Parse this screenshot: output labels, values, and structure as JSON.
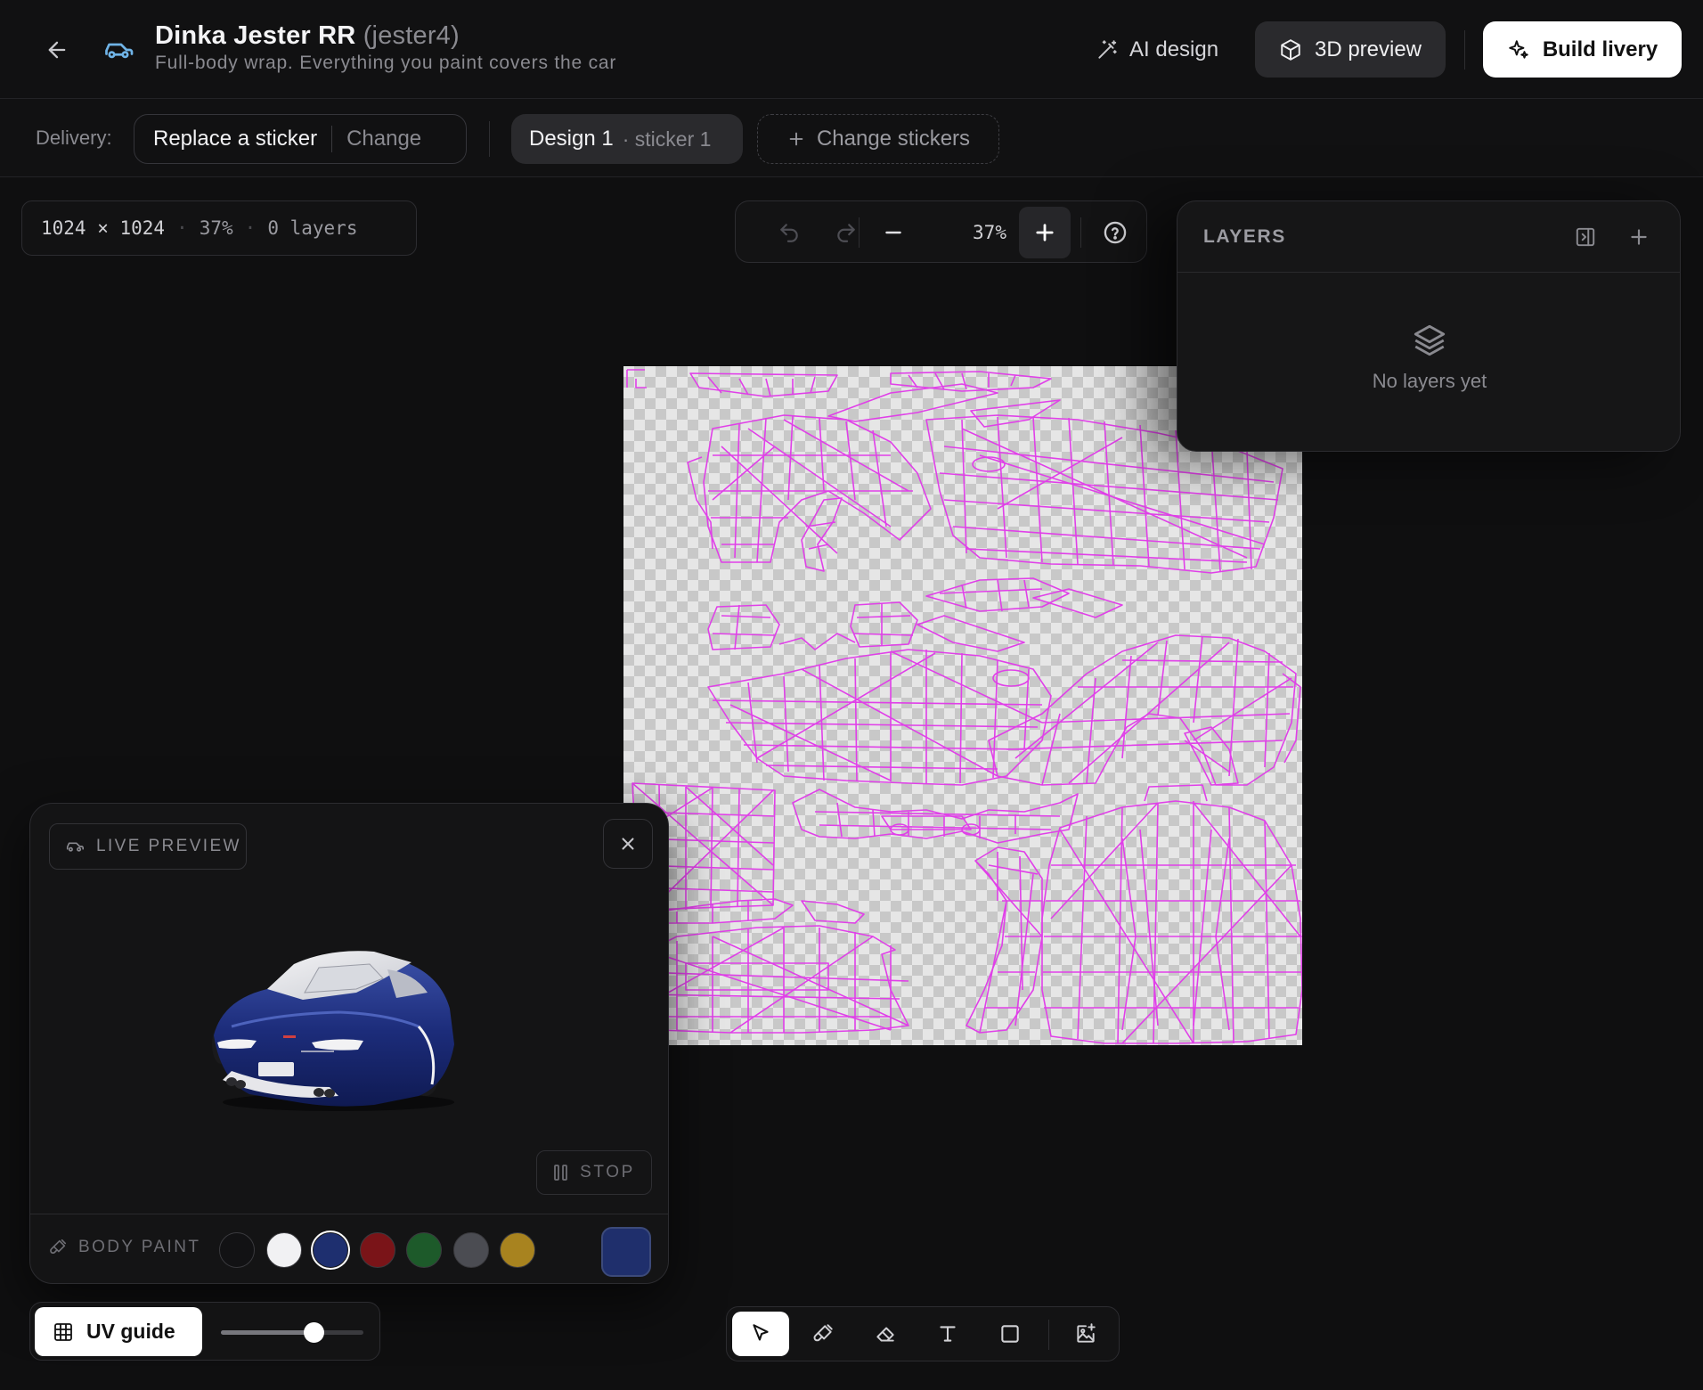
{
  "header": {
    "title": "Dinka Jester RR",
    "title_code": "(jester4)",
    "subtitle": "Full-body wrap. Everything you paint covers the car",
    "ai_design_label": "AI design",
    "preview_label": "3D preview",
    "build_label": "Build livery"
  },
  "subbar": {
    "delivery_label": "Delivery:",
    "delivery_value": "Replace a sticker",
    "delivery_change": "Change",
    "design_name": "Design 1",
    "design_meta": "· sticker 1",
    "change_stickers_label": "Change stickers"
  },
  "canvas": {
    "size": "1024 × 1024",
    "zoom": "37%",
    "layers_count": "0 layers",
    "zoom_value": "37%"
  },
  "layers_panel": {
    "title": "LAYERS",
    "empty_text": "No layers yet"
  },
  "live_preview": {
    "badge": "LIVE PREVIEW",
    "stop_label": "STOP",
    "paint_label": "BODY PAINT",
    "swatches": [
      "#121214",
      "#f1f1f3",
      "#1e2f6f",
      "#7a1418",
      "#1d5a2a",
      "#4b4c52",
      "#a8831f"
    ],
    "selected_swatch": 2,
    "custom_color": "#1f2f6c"
  },
  "uv_guide": {
    "label": "UV guide",
    "opacity": 0.65
  },
  "tools": [
    "select",
    "brush",
    "eraser",
    "text",
    "rectangle",
    "image"
  ],
  "colors": {
    "wireframe": "#e040e8",
    "accent_car_icon": "#6fb3e6"
  }
}
